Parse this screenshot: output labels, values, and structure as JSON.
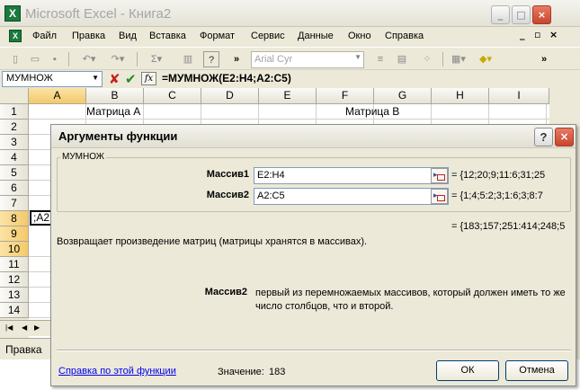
{
  "window": {
    "title": "Microsoft Excel - Книга2",
    "app_icon": "X"
  },
  "menu": {
    "items": [
      "Файл",
      "Правка",
      "Вид",
      "Вставка",
      "Формат",
      "Сервис",
      "Данные",
      "Окно",
      "Справка"
    ],
    "sheet_controls": [
      "_",
      "▫",
      "×"
    ]
  },
  "toolbar": {
    "font_name": "Arial Cyr",
    "sum_symbol": "Σ"
  },
  "formula_bar": {
    "name_box": "МУМНОЖ",
    "cancel_symbol": "✘",
    "enter_symbol": "✔",
    "fx_label": "fx",
    "formula": "=МУМНОЖ(E2:H4;A2:C5)"
  },
  "sheet": {
    "columns": [
      "A",
      "B",
      "C",
      "D",
      "E",
      "F",
      "G",
      "H",
      "I"
    ],
    "rows": [
      "1",
      "2",
      "3",
      "4",
      "5",
      "6",
      "7",
      "8",
      "9",
      "10",
      "11",
      "12",
      "13",
      "14"
    ],
    "cells": {
      "B1": "Матрица А",
      "F1": "Матрица В",
      "A8": ";A2"
    },
    "status": "Правка"
  },
  "dialog": {
    "title": "Аргументы функции",
    "help_button": "?",
    "close_button": "×",
    "function_name": "МУМНОЖ",
    "args": [
      {
        "label": "Массив1",
        "value": "E2:H4",
        "result": "= {12;20;9;11:6;31;25"
      },
      {
        "label": "Массив2",
        "value": "A2:C5",
        "result": "= {1;4;5:2;3;1:6;3;8:7"
      }
    ],
    "result": "= {183;157;251:414;248;5",
    "description": "Возвращает произведение матриц (матрицы хранятся в массивах).",
    "arg_help": {
      "label": "Массив2",
      "text": "первый из перемножаемых массивов, который должен иметь то же число столбцов, что и второй."
    },
    "help_link": "Справка по этой функции",
    "value_label": "Значение:",
    "value": "183",
    "ok": "ОК",
    "cancel": "Отмена"
  }
}
